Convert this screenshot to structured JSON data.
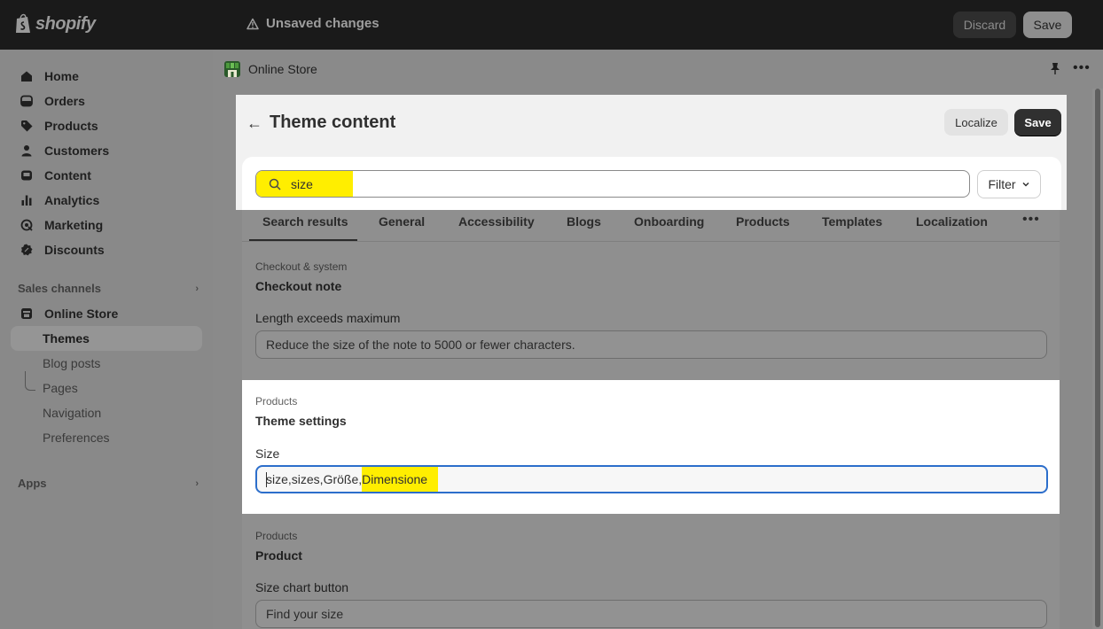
{
  "topbar": {
    "brand": "shopify",
    "status": "Unsaved changes",
    "discard_label": "Discard",
    "save_label": "Save"
  },
  "sidebar": {
    "items": [
      {
        "label": "Home",
        "icon": "home-icon"
      },
      {
        "label": "Orders",
        "icon": "orders-icon"
      },
      {
        "label": "Products",
        "icon": "tag-icon"
      },
      {
        "label": "Customers",
        "icon": "person-icon"
      },
      {
        "label": "Content",
        "icon": "content-icon"
      },
      {
        "label": "Analytics",
        "icon": "chart-icon"
      },
      {
        "label": "Marketing",
        "icon": "target-icon"
      },
      {
        "label": "Discounts",
        "icon": "discount-icon"
      }
    ],
    "sales_channels_label": "Sales channels",
    "online_store_label": "Online Store",
    "sub_items": [
      "Themes",
      "Blog posts",
      "Pages",
      "Navigation",
      "Preferences"
    ],
    "apps_label": "Apps"
  },
  "app_header": {
    "title": "Online Store"
  },
  "theme_content": {
    "title": "Theme content",
    "localize_label": "Localize",
    "save_label": "Save",
    "search_value": "size",
    "filter_label": "Filter",
    "tabs": [
      "Search results",
      "General",
      "Accessibility",
      "Blogs",
      "Onboarding",
      "Products",
      "Templates",
      "Localization"
    ],
    "results": [
      {
        "category": "Checkout & system",
        "title": "Checkout note",
        "field_label": "Length exceeds maximum",
        "field_value": "Reduce the size of the note to 5000 or fewer characters."
      },
      {
        "category": "Products",
        "title": "Theme settings",
        "field_label": "Size",
        "field_value_plain": "size,sizes,Größe,",
        "field_value_highlight": "Dimensione"
      },
      {
        "category": "Products",
        "title": "Product",
        "field_label": "Size chart button",
        "field_value": "Find your size"
      }
    ]
  },
  "colors": {
    "highlight": "#ffee00",
    "focus_border": "#2c6ecb",
    "topbar": "#1a1a1a"
  }
}
